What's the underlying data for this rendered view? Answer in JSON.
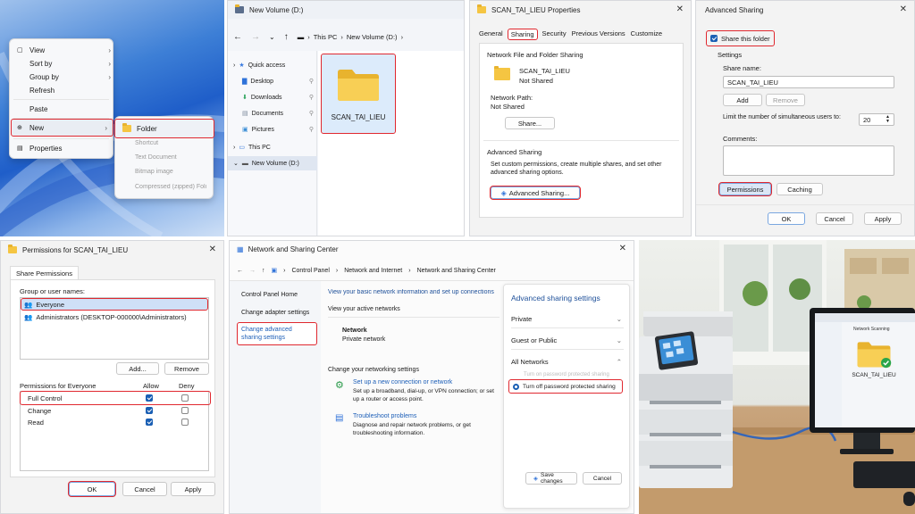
{
  "p1": {
    "menu": [
      "View",
      "Sort by",
      "Group by",
      "Refresh",
      "Paste",
      "New",
      "Properties"
    ],
    "submenu": [
      "Folder",
      "Shortcut",
      "Text Document",
      "Bitmap image",
      "Compressed (zipped) Folder"
    ]
  },
  "p2": {
    "title": "New Volume (D:)",
    "breadcrumb": [
      "This PC",
      "New Volume (D:)"
    ],
    "nav": [
      "Quick access",
      "Desktop",
      "Downloads",
      "Documents",
      "Pictures",
      "This PC",
      "New Volume (D:)"
    ],
    "folder": "SCAN_TAI_LIEU"
  },
  "p3": {
    "title": "SCAN_TAI_LIEU Properties",
    "tabs": [
      "General",
      "Sharing",
      "Security",
      "Previous Versions",
      "Customize"
    ],
    "group1": "Network File and Folder Sharing",
    "name": "SCAN_TAI_LIEU",
    "status": "Not Shared",
    "path_label": "Network Path:",
    "path": "Not Shared",
    "share_btn": "Share...",
    "group2": "Advanced Sharing",
    "desc": "Set custom permissions, create multiple shares, and set other advanced sharing options.",
    "adv_btn": "Advanced Sharing..."
  },
  "p4": {
    "title": "Advanced Sharing",
    "share_folder": "Share this folder",
    "settings": "Settings",
    "share_name_label": "Share name:",
    "share_name": "SCAN_TAI_LIEU",
    "add": "Add",
    "remove": "Remove",
    "limit": "Limit the number of simultaneous users to:",
    "limit_val": "20",
    "comments": "Comments:",
    "permissions": "Permissions",
    "caching": "Caching",
    "ok": "OK",
    "cancel": "Cancel",
    "apply": "Apply"
  },
  "p5": {
    "title": "Permissions for SCAN_TAI_LIEU",
    "tab": "Share Permissions",
    "group_label": "Group or user names:",
    "users": [
      "Everyone",
      "Administrators (DESKTOP-000000\\Administrators)"
    ],
    "add": "Add...",
    "remove": "Remove",
    "perm_for": "Permissions for Everyone",
    "allow": "Allow",
    "deny": "Deny",
    "perms": [
      "Full Control",
      "Change",
      "Read"
    ],
    "ok": "OK",
    "cancel": "Cancel",
    "apply": "Apply"
  },
  "p6": {
    "title": "Network and Sharing Center",
    "breadcrumb": [
      "Control Panel",
      "Network and Internet",
      "Network and Sharing Center"
    ],
    "side": [
      "Control Panel Home",
      "Change adapter settings",
      "Change advanced sharing settings"
    ],
    "heading": "View your basic network information and set up connections",
    "active": "View your active networks",
    "net_name": "Network",
    "net_type": "Private network",
    "change": "Change your networking settings",
    "setup_link": "Set up a new connection or network",
    "setup_desc": "Set up a broadband, dial-up, or VPN connection; or set up a router or access point.",
    "trouble_link": "Troubleshoot problems",
    "trouble_desc": "Diagnose and repair network problems, or get troubleshooting information.",
    "adv_title": "Advanced sharing settings",
    "sections": [
      "Private",
      "Guest or Public",
      "All Networks"
    ],
    "turn_on": "Turn on password protected sharing",
    "turn_off": "Turn off password protected sharing",
    "save": "Save changes",
    "cancel": "Cancel"
  },
  "p7": {
    "window": "Network Scanning",
    "folder": "SCAN_TAI_LIEU"
  }
}
